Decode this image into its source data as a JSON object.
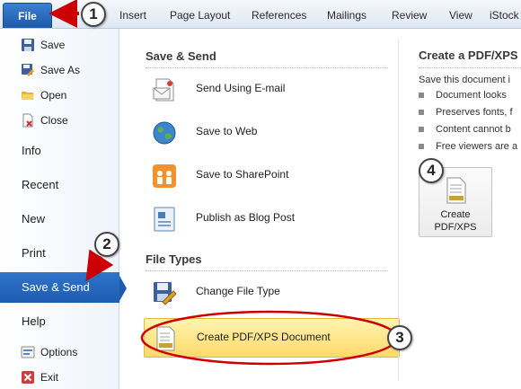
{
  "ribbon": {
    "file_tab": "File",
    "tabs": [
      "Insert",
      "Page Layout",
      "References",
      "Mailings",
      "Review",
      "View",
      "iStock"
    ]
  },
  "sidebar": {
    "small_items_top": [
      {
        "label": "Save",
        "icon": "save-icon"
      },
      {
        "label": "Save As",
        "icon": "save-as-icon"
      },
      {
        "label": "Open",
        "icon": "open-folder-icon"
      },
      {
        "label": "Close",
        "icon": "close-document-icon"
      }
    ],
    "big_items": [
      "Info",
      "Recent",
      "New",
      "Print",
      "Save & Send",
      "Help"
    ],
    "active_item": "Save & Send",
    "small_items_bottom": [
      {
        "label": "Options",
        "icon": "options-icon"
      },
      {
        "label": "Exit",
        "icon": "exit-icon"
      }
    ]
  },
  "middle": {
    "save_send_heading": "Save & Send",
    "save_send_items": [
      {
        "label": "Send Using E-mail",
        "icon": "email-icon"
      },
      {
        "label": "Save to Web",
        "icon": "globe-icon"
      },
      {
        "label": "Save to SharePoint",
        "icon": "sharepoint-icon"
      },
      {
        "label": "Publish as Blog Post",
        "icon": "blog-icon"
      }
    ],
    "file_types_heading": "File Types",
    "file_types_items": [
      {
        "label": "Change File Type",
        "icon": "change-file-type-icon"
      },
      {
        "label": "Create PDF/XPS Document",
        "icon": "pdf-document-icon",
        "highlighted": true
      }
    ]
  },
  "right": {
    "title": "Create a PDF/XPS",
    "intro": "Save this document i",
    "bullets": [
      "Document looks",
      "Preserves fonts, f",
      "Content cannot b",
      "Free viewers are a"
    ],
    "button_line1": "Create",
    "button_line2": "PDF/XPS"
  },
  "annotations": [
    "1",
    "2",
    "3",
    "4"
  ],
  "colors": {
    "file_tab": "#1f5aa8",
    "active_nav": "#1e5bb0",
    "highlight": "#ffd96a",
    "callout_red": "#cc0000"
  }
}
